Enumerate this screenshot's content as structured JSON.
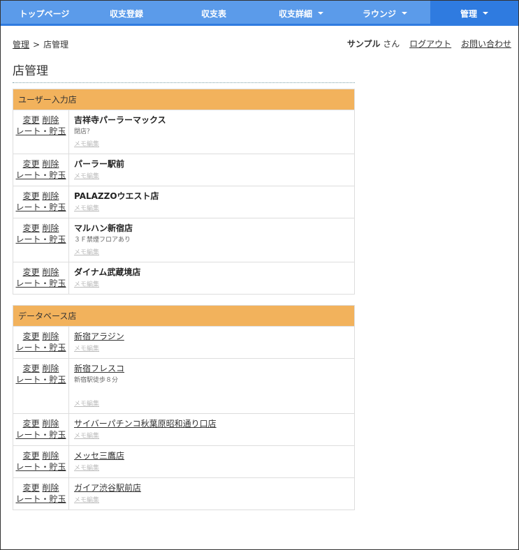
{
  "nav": [
    {
      "label": "トップページ",
      "width": 125,
      "caret": false,
      "active": false
    },
    {
      "label": "収支登録",
      "width": 110,
      "caret": false,
      "active": false
    },
    {
      "label": "収支表",
      "width": 140,
      "caret": false,
      "active": false
    },
    {
      "label": "収支詳細",
      "width": 110,
      "caret": true,
      "active": false
    },
    {
      "label": "ラウンジ",
      "width": 130,
      "caret": true,
      "active": false
    },
    {
      "label": "管理",
      "width": 126,
      "caret": true,
      "active": true
    }
  ],
  "breadcrumb": {
    "parent": "管理",
    "separator": ">",
    "current": "店管理"
  },
  "user": {
    "name": "サンプル",
    "suffix": "さん",
    "logout": "ログアウト",
    "contact": "お問い合わせ"
  },
  "page_title": "店管理",
  "actions": {
    "edit": "変更",
    "delete": "削除",
    "rate": "レート・貯玉"
  },
  "memo_label": "メモ編集",
  "user_shops": {
    "title": "ユーザー入力店",
    "rows": [
      {
        "name": "吉祥寺パーラーマックス",
        "note": "閉店？"
      },
      {
        "name": "パーラー駅前",
        "note": ""
      },
      {
        "name": "PALAZZOウエスト店",
        "note": ""
      },
      {
        "name": "マルハン新宿店",
        "note": "３Ｆ禁煙フロアあり"
      },
      {
        "name": "ダイナム武蔵境店",
        "note": ""
      }
    ]
  },
  "db_shops": {
    "title": "データベース店",
    "rows": [
      {
        "name": "新宿アラジン",
        "note": ""
      },
      {
        "name": "新宿フレスコ",
        "note": "新宿駅徒歩８分"
      },
      {
        "name": "サイバーパチンコ秋葉原昭和通り口店",
        "note": ""
      },
      {
        "name": "メッセ三鷹店",
        "note": ""
      },
      {
        "name": "ガイア渋谷駅前店",
        "note": ""
      }
    ]
  },
  "colors": {
    "nav_bg": "#5b9bea",
    "nav_active": "#2f7be0",
    "panel_head": "#f2b25c"
  }
}
